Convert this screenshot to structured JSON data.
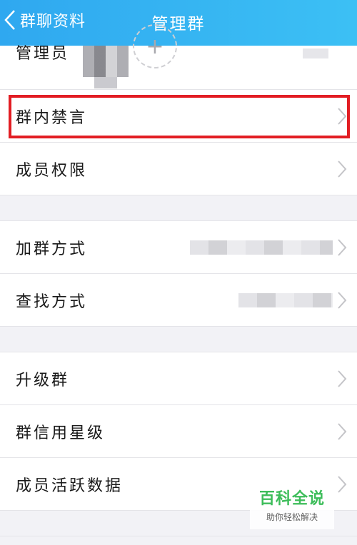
{
  "navbar": {
    "back_label": "群聊资料",
    "title": "管理群"
  },
  "rows": {
    "admin": "管理员",
    "admin_add_symbol": "+",
    "mute": "群内禁言",
    "member_permissions": "成员权限",
    "join_method": "加群方式",
    "find_method": "查找方式",
    "upgrade": "升级群",
    "credit_level": "群信用星级",
    "active_data": "成员活跃数据"
  },
  "watermark": {
    "title": "百科全说",
    "subtitle": "助你轻松解决"
  },
  "colors": {
    "navbar": "#33b1f2",
    "highlight": "#e21d23",
    "watermark_green": "#2db84d"
  }
}
